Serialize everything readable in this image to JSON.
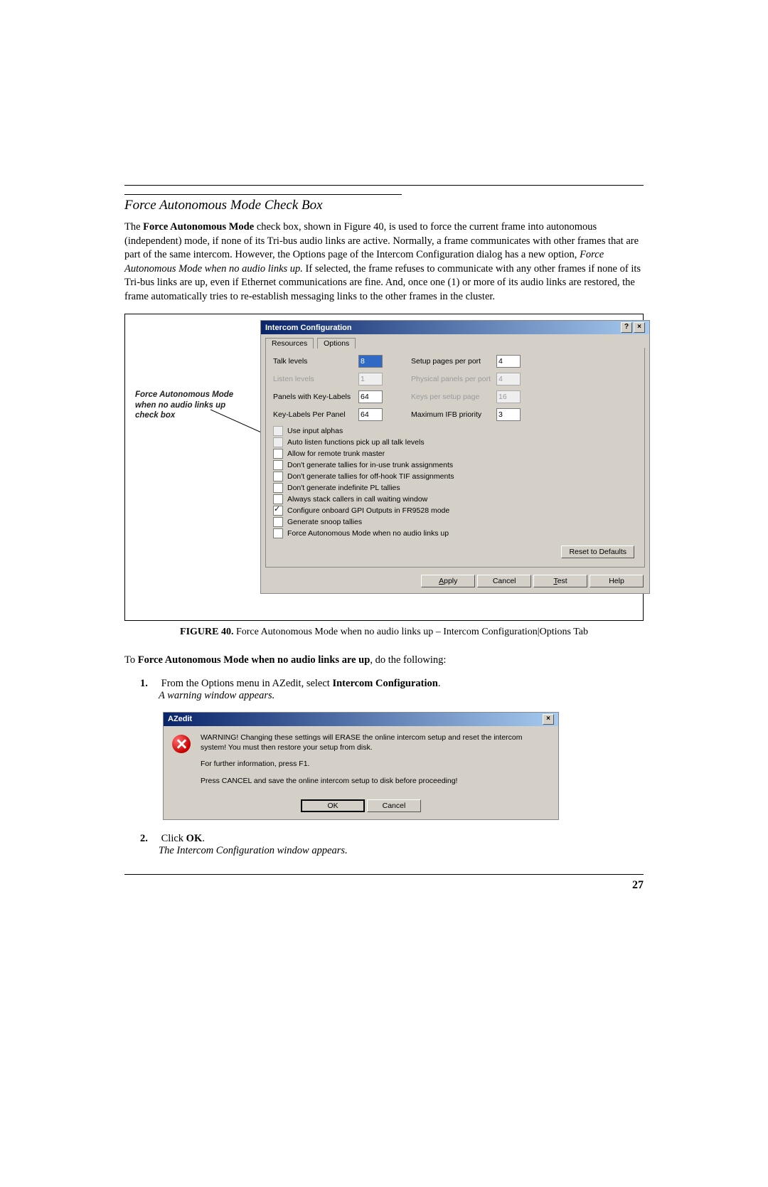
{
  "section_title": "Force Autonomous Mode Check Box",
  "para": {
    "p1_a": "The ",
    "p1_b": "Force Autonomous Mode",
    "p1_c": " check box, shown in Figure 40, is used to force the current frame into autonomous (independent) mode, if none of its Tri-bus audio links are active. Normally, a frame communicates with other frames that are part of the same intercom. However, the Options page of the Intercom Configuration dialog has a new option, ",
    "p1_d": "Force Autonomous Mode when no audio links up.",
    "p1_e": " If selected, the frame refuses to communicate with any other frames if none of its Tri-bus links are up, even if Ethernet communications are fine. And, once one (1) or more of its audio links are restored, the frame automatically tries to re-establish messaging links to the other frames in the cluster."
  },
  "annotation": "Force Autonomous Mode when no audio links up check box",
  "dialog": {
    "title": "Intercom Configuration",
    "tab_resources": "Resources",
    "tab_options": "Options",
    "rows": {
      "talk_levels": "Talk levels",
      "talk_levels_v": "8",
      "setup_pages": "Setup pages per port",
      "setup_pages_v": "4",
      "listen_levels": "Listen levels",
      "listen_levels_v": "1",
      "phys_panels": "Physical panels per port",
      "phys_panels_v": "4",
      "panels_key": "Panels with Key-Labels",
      "panels_key_v": "64",
      "keys_per_page": "Keys per setup page",
      "keys_per_page_v": "16",
      "keylabels_panel": "Key-Labels Per Panel",
      "keylabels_panel_v": "64",
      "max_ifb": "Maximum IFB priority",
      "max_ifb_v": "3"
    },
    "cbs": {
      "c1": "Use input alphas",
      "c2": "Auto listen functions pick up all talk levels",
      "c3": "Allow for remote trunk master",
      "c4": "Don't generate tallies for in-use trunk assignments",
      "c5": "Don't generate tallies for off-hook TIF assignments",
      "c6": "Don't generate indefinite PL tallies",
      "c7": "Always stack callers in call waiting window",
      "c8": "Configure onboard GPI Outputs in FR9528 mode",
      "c9": "Generate snoop tallies",
      "c10": "Force Autonomous Mode when no audio links up"
    },
    "reset": "Reset to Defaults",
    "apply": "Apply",
    "cancel": "Cancel",
    "test": "Test",
    "help": "Help"
  },
  "figure_caption_a": "FIGURE 40.",
  "figure_caption_b": " Force Autonomous Mode when no audio links up – Intercom Configuration|Options Tab",
  "instr": {
    "lead_a": "To ",
    "lead_b": "Force Autonomous Mode when no audio links are up",
    "lead_c": ", do the following:",
    "s1_n": "1.",
    "s1_a": "From the Options menu in AZedit, select ",
    "s1_b": "Intercom Configuration",
    "s1_c": ".",
    "s1_i": "A warning window appears.",
    "s2_n": "2.",
    "s2_a": "Click ",
    "s2_b": "OK",
    "s2_c": ".",
    "s2_i": "The Intercom Configuration window appears."
  },
  "warn": {
    "title": "AZedit",
    "l1": "WARNING! Changing these settings will ERASE the online intercom setup and reset the intercom system! You must then restore your setup from disk.",
    "l2": "For further information, press F1.",
    "l3": "Press CANCEL and save the online intercom setup to disk before proceeding!",
    "ok": "OK",
    "cancel": "Cancel"
  },
  "page_number": "27"
}
